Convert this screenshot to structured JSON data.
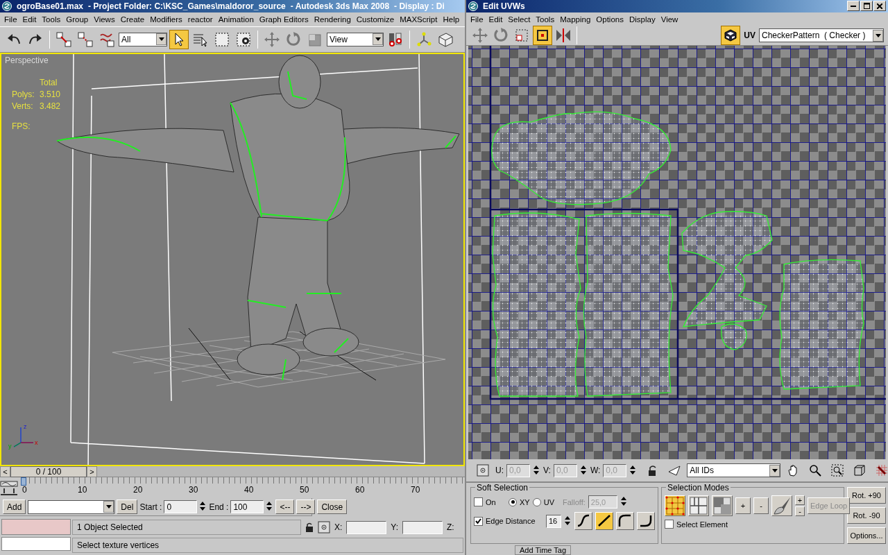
{
  "main_window": {
    "title_parts": [
      "ogroBase01.max",
      "- Project Folder: C:\\KSC_Games\\maldoror_source",
      "- Autodesk 3ds Max 2008",
      "- Display : Di"
    ],
    "menu": [
      "File",
      "Edit",
      "Tools",
      "Group",
      "Views",
      "Create",
      "Modifiers",
      "reactor",
      "Animation",
      "Graph Editors",
      "Rendering",
      "Customize",
      "MAXScript",
      "Help"
    ],
    "toolbar": [
      {
        "kind": "undo",
        "selected": false
      },
      {
        "kind": "redo",
        "selected": false
      },
      {
        "kind": "sep"
      },
      {
        "kind": "link",
        "selected": false
      },
      {
        "kind": "unlink",
        "selected": false
      },
      {
        "kind": "bind",
        "selected": false
      },
      {
        "kind": "dropdown",
        "value": "All"
      },
      {
        "kind": "select",
        "selected": true
      },
      {
        "kind": "select-by-name",
        "selected": false
      },
      {
        "kind": "region",
        "selected": false
      },
      {
        "kind": "crossing",
        "selected": false
      },
      {
        "kind": "sep"
      },
      {
        "kind": "move",
        "selected": false
      },
      {
        "kind": "rotate",
        "selected": false
      },
      {
        "kind": "scale",
        "selected": false
      },
      {
        "kind": "dropdown",
        "value": "View"
      },
      {
        "kind": "pivot",
        "selected": false
      },
      {
        "kind": "sep"
      },
      {
        "kind": "manipulate",
        "selected": false
      },
      {
        "kind": "box",
        "selected": false
      }
    ]
  },
  "viewport": {
    "label": "Perspective",
    "active": true,
    "stats_header": "Total",
    "stats": [
      {
        "label": "Polys:",
        "value": "3.510"
      },
      {
        "label": "Verts:",
        "value": "3.482"
      }
    ],
    "fps_label": "FPS:",
    "axes": [
      "z",
      "y",
      "x"
    ]
  },
  "time_slider": {
    "prev": "<",
    "label": "0 / 100",
    "next": ">",
    "level": 0
  },
  "track_bar": {
    "ticks": [
      "0",
      "10",
      "20",
      "30",
      "40",
      "50",
      "60",
      "70"
    ]
  },
  "time_tags": {
    "add": "Add",
    "del": "Del",
    "start_label": "Start :",
    "start": "0",
    "end_label": "End :",
    "end": "100",
    "back": "<--",
    "forward": "-->",
    "close": "Close"
  },
  "status": {
    "selection": "1 Object Selected",
    "prompt": "Select texture vertices",
    "x_label": "X:",
    "y_label": "Y:",
    "z_label": "Z:"
  },
  "uvw_window": {
    "title": "Edit UVWs",
    "menu": [
      "File",
      "Edit",
      "Select",
      "Tools",
      "Mapping",
      "Options",
      "Display",
      "View"
    ],
    "toolbar": [
      {
        "kind": "move",
        "selected": false
      },
      {
        "kind": "rotate",
        "selected": false
      },
      {
        "kind": "scale",
        "selected": false
      },
      {
        "kind": "freeform",
        "selected": true
      },
      {
        "kind": "mirror",
        "selected": false
      }
    ],
    "checker_button": {
      "selected": true
    },
    "uv_label": "UV",
    "texture": "CheckerPattern  ( Checker )",
    "coords": [
      {
        "label": "U:",
        "value": "0,0"
      },
      {
        "label": "V:",
        "value": "0,0"
      },
      {
        "label": "W:",
        "value": "0,0"
      }
    ],
    "id_filter": "All IDs",
    "soft_selection": {
      "title": "Soft Selection",
      "on": {
        "label": "On",
        "checked": false
      },
      "space": [
        {
          "label": "XY",
          "selected": true
        },
        {
          "label": "UV",
          "selected": false
        }
      ],
      "falloff_label": "Falloff:",
      "falloff": "25,0",
      "edge_distance": {
        "label": "Edge Distance",
        "checked": true
      },
      "distance": "16",
      "curves": [
        {
          "kind": "smooth",
          "selected": false
        },
        {
          "kind": "linear",
          "selected": true
        },
        {
          "kind": "slow-out",
          "selected": false
        },
        {
          "kind": "fast-out",
          "selected": false
        }
      ]
    },
    "selection_modes": {
      "title": "Selection Modes",
      "modes": [
        {
          "kind": "vertex",
          "selected": true
        },
        {
          "kind": "edge",
          "selected": false
        },
        {
          "kind": "face",
          "selected": false
        }
      ],
      "grow": "+",
      "shrink": "-",
      "loop_grow": "+",
      "loop_shrink": "-",
      "edge_loop": "Edge Loop",
      "select_element": {
        "label": "Select Element",
        "checked": false
      }
    },
    "rotate_buttons": [
      "Rot. +90",
      "Rot. -90",
      "Options..."
    ]
  },
  "hidden_strip": {
    "time_tag": "Add Time Tag"
  }
}
